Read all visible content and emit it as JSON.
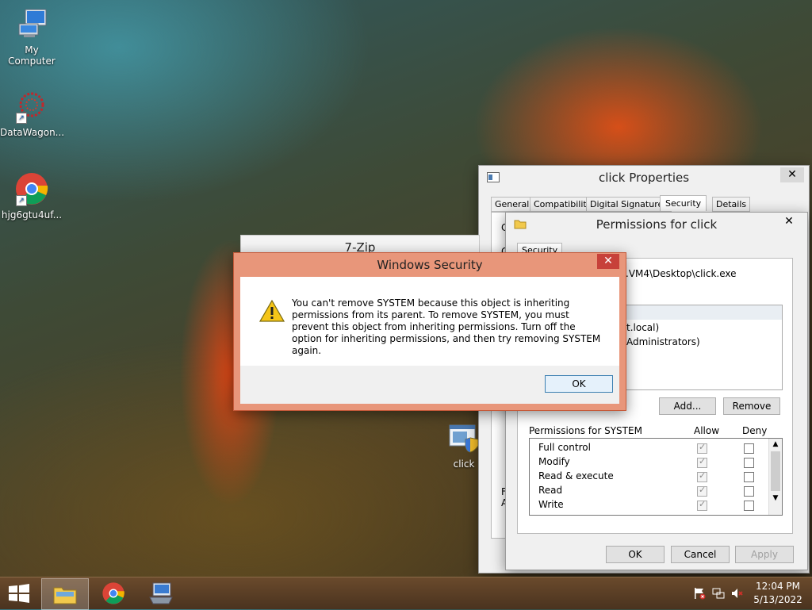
{
  "desktop": {
    "icons": [
      {
        "label": "My Computer",
        "icon": "computer-icon"
      },
      {
        "label": "DataWagon...",
        "icon": "datawagon-icon"
      },
      {
        "label": "hjg6gtu4uf...",
        "icon": "chrome-icon"
      },
      {
        "label": "click",
        "icon": "exe-shield-icon"
      }
    ]
  },
  "properties": {
    "title": "click Properties",
    "tabs": [
      "General",
      "Compatibility",
      "Digital Signatures",
      "Security",
      "Details"
    ],
    "active_tab": "Security",
    "ok": "OK",
    "cancel": "Cancel",
    "apply": "Apply",
    "peek_left": [
      "C",
      "G",
      "F",
      "A"
    ]
  },
  "permissions": {
    "title": "Permissions for click",
    "inner_tab": "Security",
    "object_path": ".VM4\\Desktop\\click.exe",
    "principals": [
      "t.local)",
      "Administrators)"
    ],
    "add": "Add...",
    "remove": "Remove",
    "perm_header": "Permissions for SYSTEM",
    "allow": "Allow",
    "deny": "Deny",
    "rows": [
      {
        "name": "Full control",
        "allow": true,
        "deny": false
      },
      {
        "name": "Modify",
        "allow": true,
        "deny": false
      },
      {
        "name": "Read & execute",
        "allow": true,
        "deny": false
      },
      {
        "name": "Read",
        "allow": true,
        "deny": false
      },
      {
        "name": "Write",
        "allow": true,
        "deny": false
      }
    ]
  },
  "zip": {
    "title": "7-Zip"
  },
  "security_dialog": {
    "title": "Windows Security",
    "message": "You can't remove SYSTEM because this object is inheriting permissions from its parent. To remove SYSTEM, you must prevent this object from inheriting permissions.  Turn off the option for inheriting permissions, and then try removing SYSTEM again.",
    "ok": "OK"
  },
  "taskbar": {
    "time": "12:04 PM",
    "date": "5/13/2022",
    "apps": [
      "file-explorer-icon",
      "chrome-icon",
      "network-app-icon"
    ],
    "tray": [
      "action-center-flag-icon",
      "network-icon",
      "speaker-muted-icon"
    ]
  }
}
